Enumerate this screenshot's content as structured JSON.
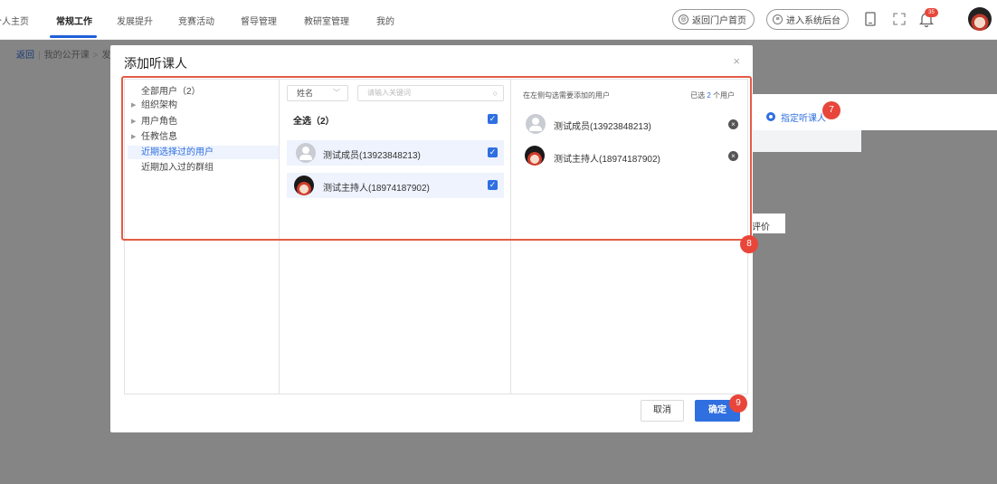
{
  "topnav": {
    "items": [
      "个人主页",
      "常规工作",
      "发展提升",
      "竞赛活动",
      "督导管理",
      "教研室管理",
      "我的"
    ],
    "active_index": 1,
    "back_portal_label": "返回门户首页",
    "enter_admin_label": "进入系统后台",
    "notification_count": "35"
  },
  "breadcrumb": {
    "back": "返回",
    "current": "我的公开课",
    "next": "发"
  },
  "background": {
    "assign_listener": "指定听课人",
    "evaluation_fragment": "评价"
  },
  "dialog": {
    "title": "添加听课人",
    "close_label": "×",
    "tree": [
      {
        "label": "全部用户（2）",
        "caret": false,
        "selected": false
      },
      {
        "label": "组织架构",
        "caret": true,
        "selected": false
      },
      {
        "label": "用户角色",
        "caret": true,
        "selected": false
      },
      {
        "label": "任教信息",
        "caret": true,
        "selected": false
      },
      {
        "label": "近期选择过的用户",
        "caret": false,
        "selected": true
      },
      {
        "label": "近期加入过的群组",
        "caret": false,
        "selected": false
      }
    ],
    "search": {
      "field_select": "姓名",
      "placeholder": "请输入关键词"
    },
    "select_all_label": "全选（2）",
    "users": [
      {
        "name": "测试成员(13923848213)",
        "avatar": "default-avatar",
        "checked": true
      },
      {
        "name": "测试主持人(18974187902)",
        "avatar": "photo-avatar",
        "checked": true
      }
    ],
    "selected_panel": {
      "hint": "在左侧勾选需要添加的用户",
      "count_prefix": "已选",
      "count": "2",
      "count_suffix": "个用户",
      "users": [
        "测试成员(13923848213)",
        "测试主持人(18974187902)"
      ]
    },
    "cancel_label": "取消",
    "ok_label": "确定"
  },
  "markers": [
    "7",
    "8",
    "9"
  ],
  "colors": {
    "accent": "#2f6fe0",
    "marker": "#e8463a",
    "highlight_box": "#e35b45"
  }
}
